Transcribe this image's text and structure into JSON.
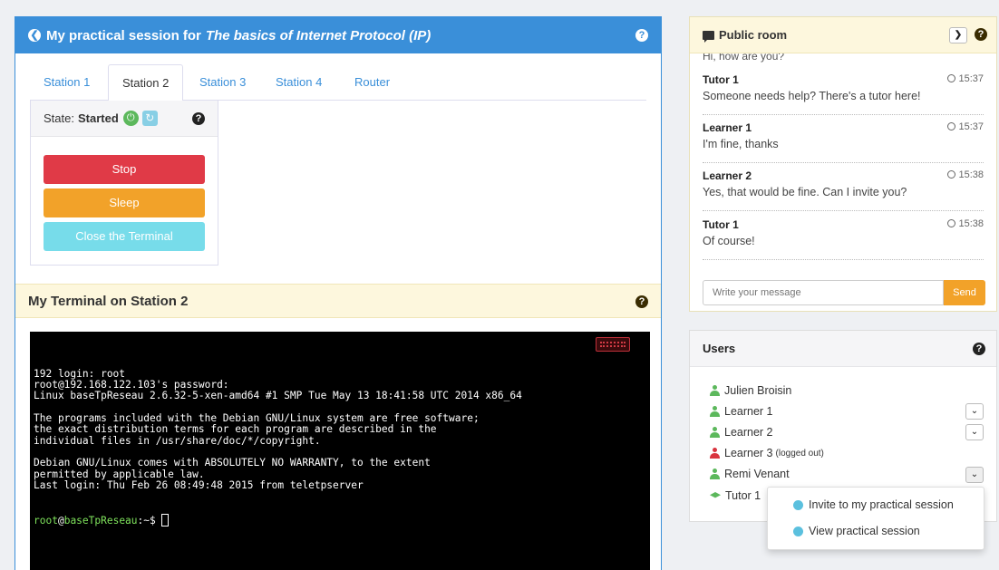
{
  "session": {
    "title_prefix": "My practical session for",
    "title_italic": "The basics of Internet Protocol (IP)"
  },
  "tabs": [
    {
      "label": "Station 1"
    },
    {
      "label": "Station 2"
    },
    {
      "label": "Station 3"
    },
    {
      "label": "Station 4"
    },
    {
      "label": "Router"
    }
  ],
  "state": {
    "label": "State:",
    "value": "Started",
    "buttons": {
      "stop": "Stop",
      "sleep": "Sleep",
      "close": "Close the Terminal"
    }
  },
  "terminal": {
    "title": "My Terminal on Station 2",
    "lines": [
      "192 login: root",
      "root@192.168.122.103's password:",
      "Linux baseTpReseau 2.6.32-5-xen-amd64 #1 SMP Tue May 13 18:41:58 UTC 2014 x86_64",
      "",
      "The programs included with the Debian GNU/Linux system are free software;",
      "the exact distribution terms for each program are described in the",
      "individual files in /usr/share/doc/*/copyright.",
      "",
      "Debian GNU/Linux comes with ABSOLUTELY NO WARRANTY, to the extent",
      "permitted by applicable law.",
      "Last login: Thu Feb 26 08:49:48 2015 from teletpserver"
    ],
    "prompt_user": "root",
    "prompt_host": "baseTpReseau",
    "prompt_suffix": ":~$ "
  },
  "chat": {
    "title": "Public room",
    "cut_text": "Hi, how are you?",
    "messages": [
      {
        "author": "Tutor 1",
        "time": "15:37",
        "text": "Someone needs help? There's a tutor here!"
      },
      {
        "author": "Learner 1",
        "time": "15:37",
        "text": "I'm fine, thanks"
      },
      {
        "author": "Learner 2",
        "time": "15:38",
        "text": "Yes, that would be fine. Can I invite you?"
      },
      {
        "author": "Tutor 1",
        "time": "15:38",
        "text": "Of course!"
      }
    ],
    "input_placeholder": "Write your message",
    "send_label": "Send"
  },
  "users": {
    "title": "Users",
    "list": [
      {
        "name": "Julien Broisin",
        "status": "online"
      },
      {
        "name": "Learner 1",
        "status": "online"
      },
      {
        "name": "Learner 2",
        "status": "online"
      },
      {
        "name": "Learner 3",
        "status": "logged out",
        "note": "(logged out)"
      },
      {
        "name": "Remi Venant",
        "status": "online"
      },
      {
        "name": "Tutor 1",
        "status": "tutor"
      }
    ]
  },
  "popup_menu": {
    "invite": "Invite to my practical session",
    "view": "View practical session"
  },
  "colors": {
    "primary": "#3a8fd9",
    "danger": "#e03a47",
    "warning": "#f2a229",
    "info": "#77dcea",
    "online": "#5cb85c",
    "offline": "#d9343f"
  }
}
